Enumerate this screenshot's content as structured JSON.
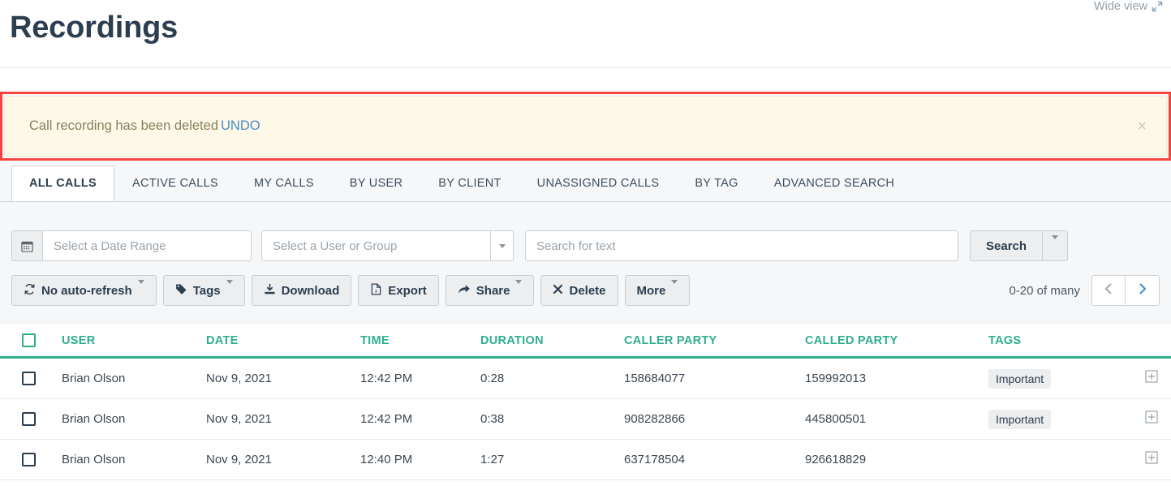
{
  "header": {
    "title": "Recordings",
    "wide_view_label": "Wide view",
    "wide_view_icon": "expand-diagonal-icon"
  },
  "alert": {
    "message": "Call recording has been deleted",
    "undo_label": "UNDO",
    "close_label": "×",
    "bg_color": "#fdf8e7",
    "text_color": "#8a7f5e",
    "link_color": "#4b8ec9",
    "highlight_border_color": "#f6453f"
  },
  "tabs": [
    {
      "label": "ALL CALLS",
      "active": true
    },
    {
      "label": "ACTIVE CALLS",
      "active": false
    },
    {
      "label": "MY CALLS",
      "active": false
    },
    {
      "label": "BY USER",
      "active": false
    },
    {
      "label": "BY CLIENT",
      "active": false
    },
    {
      "label": "UNASSIGNED CALLS",
      "active": false
    },
    {
      "label": "BY TAG",
      "active": false
    },
    {
      "label": "ADVANCED SEARCH",
      "active": false
    }
  ],
  "filters": {
    "date_range": {
      "placeholder": "Select a Date Range",
      "value": "",
      "icon": "calendar-icon"
    },
    "user_group": {
      "placeholder": "Select a User or Group",
      "value": "",
      "icon": "chevron-down-icon"
    },
    "text_search": {
      "placeholder": "Search for text",
      "value": ""
    },
    "search_button": {
      "label": "Search",
      "split_icon": "caret-down-icon"
    }
  },
  "toolbar": {
    "auto_refresh": {
      "label": "No auto-refresh",
      "icon": "refresh-icon",
      "caret": true
    },
    "tags": {
      "label": "Tags",
      "icon": "tag-icon",
      "caret": true
    },
    "download": {
      "label": "Download",
      "icon": "download-icon"
    },
    "export": {
      "label": "Export",
      "icon": "excel-file-icon"
    },
    "share": {
      "label": "Share",
      "icon": "share-arrow-icon",
      "caret": true
    },
    "delete": {
      "label": "Delete",
      "icon": "x-icon"
    },
    "more": {
      "label": "More",
      "caret": true
    }
  },
  "pagination": {
    "range_label": "0-20 of many",
    "prev_icon": "chevron-left-icon",
    "next_icon": "chevron-right-icon",
    "prev_color": "#a2abb2",
    "next_color": "#3e8fd4"
  },
  "table": {
    "accent_color": "#2fae8f",
    "select_all_checkbox": "select-all",
    "columns": [
      "USER",
      "DATE",
      "TIME",
      "DURATION",
      "CALLER PARTY",
      "CALLED PARTY",
      "TAGS"
    ],
    "rows": [
      {
        "user": "Brian Olson",
        "date": "Nov 9, 2021",
        "time": "12:42 PM",
        "duration": "0:28",
        "caller_party": "158684077",
        "called_party": "159992013",
        "tag": "Important"
      },
      {
        "user": "Brian Olson",
        "date": "Nov 9, 2021",
        "time": "12:42 PM",
        "duration": "0:38",
        "caller_party": "908282866",
        "called_party": "445800501",
        "tag": "Important"
      },
      {
        "user": "Brian Olson",
        "date": "Nov 9, 2021",
        "time": "12:40 PM",
        "duration": "1:27",
        "caller_party": "637178504",
        "called_party": "926618829",
        "tag": ""
      }
    ]
  }
}
